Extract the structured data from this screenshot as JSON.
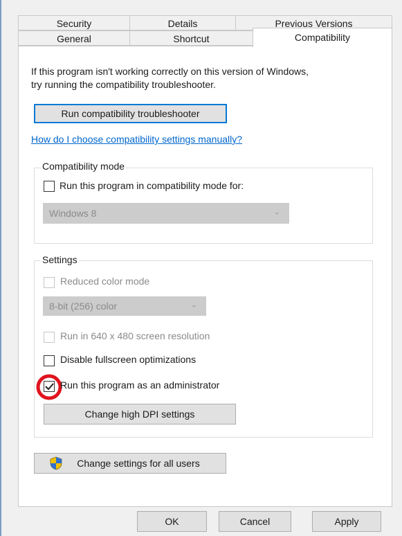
{
  "tabs": {
    "row1": [
      "Security",
      "Details",
      "Previous Versions"
    ],
    "row2": [
      "General",
      "Shortcut",
      "Compatibility"
    ]
  },
  "intro": {
    "line1": "If this program isn't working correctly on this version of Windows,",
    "line2": "try running the compatibility troubleshooter."
  },
  "troubleshooter_button": "Run compatibility troubleshooter",
  "help_link": "How do I choose compatibility settings manually?",
  "compat_mode": {
    "title": "Compatibility mode",
    "checkbox_label": "Run this program in compatibility mode for:",
    "checked": false,
    "os_value": "Windows 8"
  },
  "settings": {
    "title": "Settings",
    "reduced_color": {
      "label": "Reduced color mode",
      "checked": false,
      "enabled": false
    },
    "color_value": "8-bit (256) color",
    "run_640": {
      "label": "Run in 640 x 480 screen resolution",
      "checked": false,
      "enabled": false
    },
    "disable_fullscreen": {
      "label": "Disable fullscreen optimizations",
      "checked": false,
      "enabled": true
    },
    "run_admin": {
      "label": "Run this program as an administrator",
      "checked": true,
      "enabled": true
    },
    "dpi_button": "Change high DPI settings"
  },
  "all_users_button": "Change settings for all users",
  "footer": {
    "ok": "OK",
    "cancel": "Cancel",
    "apply": "Apply"
  },
  "colors": {
    "link": "#0066cc",
    "focus_border": "#0078d7",
    "highlight_circle": "#e0141e"
  }
}
